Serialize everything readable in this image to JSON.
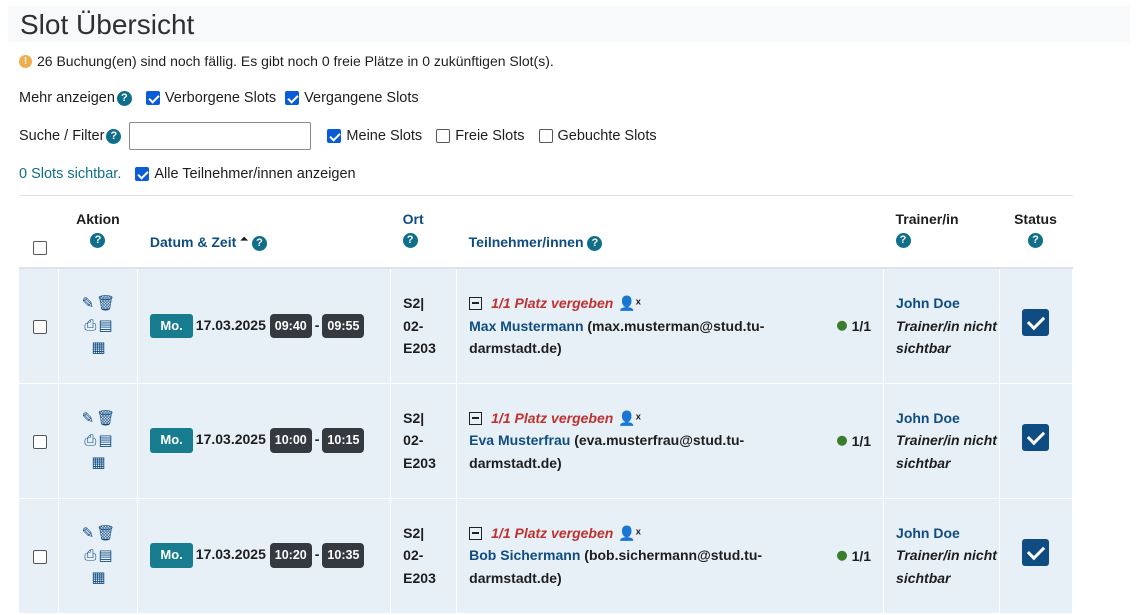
{
  "page": {
    "title": "Slot Übersicht",
    "notice": "26 Buchung(en) sind noch fällig. Es gibt noch 0 freie Plätze in 0 zukünftigen Slot(s)."
  },
  "filters": {
    "more_label": "Mehr anzeigen",
    "hidden_slots": {
      "label": "Verborgene Slots",
      "checked": true
    },
    "past_slots": {
      "label": "Vergangene Slots",
      "checked": true
    },
    "search_label": "Suche / Filter",
    "search_value": "",
    "my_slots": {
      "label": "Meine Slots",
      "checked": true
    },
    "free_slots": {
      "label": "Freie Slots",
      "checked": false
    },
    "booked_slots": {
      "label": "Gebuchte Slots",
      "checked": false
    },
    "visible_count": "0 Slots sichtbar.",
    "all_participants": {
      "label": "Alle Teilnehmer/innen anzeigen",
      "checked": true
    }
  },
  "table": {
    "headers": {
      "action": "Aktion",
      "datetime": "Datum & Zeit",
      "location": "Ort",
      "participants": "Teilnehmer/innen",
      "trainer": "Trainer/in",
      "status": "Status"
    },
    "help_glyph": "?",
    "sort_glyph": "⏶",
    "rows": [
      {
        "day": "Mo.",
        "date": "17.03.2025",
        "start": "09:40",
        "end": "09:55",
        "location": "S2| 02-E203",
        "booked": "1/1 Platz vergeben",
        "participant_name": "Max Mustermann",
        "participant_email": "(max.musterman@stud.tu-darmstadt.de)",
        "count": "1/1",
        "trainer": "John Doe",
        "trainer_note": "Trainer/in nicht sichtbar"
      },
      {
        "day": "Mo.",
        "date": "17.03.2025",
        "start": "10:00",
        "end": "10:15",
        "location": "S2| 02-E203",
        "booked": "1/1 Platz vergeben",
        "participant_name": "Eva Musterfrau",
        "participant_email": "(eva.musterfrau@stud.tu-darmstadt.de)",
        "count": "1/1",
        "trainer": "John Doe",
        "trainer_note": "Trainer/in nicht sichtbar"
      },
      {
        "day": "Mo.",
        "date": "17.03.2025",
        "start": "10:20",
        "end": "10:35",
        "location": "S2| 02-E203",
        "booked": "1/1 Platz vergeben",
        "participant_name": "Bob Sichermann",
        "participant_email": "(bob.sichermann@stud.tu-darmstadt.de)",
        "count": "1/1",
        "trainer": "John Doe",
        "trainer_note": "Trainer/in nicht sichtbar"
      }
    ]
  },
  "icons": {
    "warning": "exclamation-circle-icon",
    "edit": "pencil-icon",
    "delete": "trash-icon",
    "print": "printer-icon",
    "list": "table-list-icon",
    "calendar": "calendar-icon",
    "user_remove": "user-x-icon",
    "collapse": "minus-square-icon"
  },
  "colors": {
    "accent": "#0f4c81",
    "help_badge": "#0f6f8a",
    "booked_red": "#c0322f",
    "day_badge": "#177d8e",
    "row_bg": "#e7eff7",
    "status_green": "#3a7d2a"
  }
}
